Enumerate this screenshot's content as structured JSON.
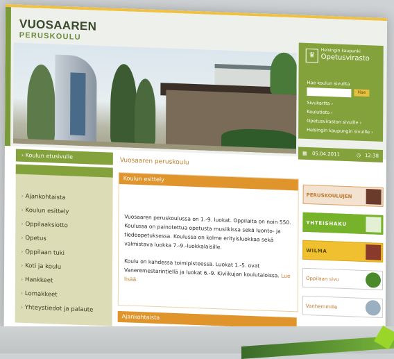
{
  "logo": {
    "line1": "VUOSAAREN",
    "line2": "PERUSKOULU"
  },
  "panel": {
    "org_small": "Helsingin kaupunki",
    "org_name": "Opetusvirasto",
    "search_label": "Hae koulun sivuilta",
    "search_value": "",
    "search_button": "Hae",
    "links": [
      "Sivukartta ›",
      "Koulutieto ›",
      "Opetusviraston sivuille ›",
      "Helsingin kaupungin sivuille ›"
    ]
  },
  "datebar": {
    "date": "05.04.2011",
    "time": "12:38"
  },
  "nav": {
    "front_tab": "Koulun etusivulle",
    "items": [
      "Ajankohtaista",
      "Koulun esittely",
      "Oppilaaksiotto",
      "Opetus",
      "Oppilaan tuki",
      "Koti ja koulu",
      "Hankkeet",
      "Lomakkeet",
      "Yhteystiedot ja palaute"
    ]
  },
  "breadcrumb": "Vuosaaren peruskoulu",
  "content": {
    "heading": "Koulun esittely",
    "para1": "Vuosaaren peruskoulussa on 1.-9. luokat. Oppilaita on noin 550. Koulussa on painotettua opetusta musiikissa sekä luonto- ja tiedeopetuksessa. Koulussa on kolme erityisluokkaa sekä valmistava luokka 7.-9.-luokkalaisille.",
    "para2": "Koulu on kahdessa toimipisteessä. Luokat 1.-5. ovat Vaneremestarintiellä ja luokat 6.-9. Kiviikujan koulutaloissa.",
    "more_link": "Lue lisää.",
    "heading2": "Ajankohtaista"
  },
  "banners": [
    "PERUSKOULUJEN ERIKOISTAITUMINEN",
    "YHTEISHAKU",
    "WILMA",
    "Oppilaan sivu",
    "Vanhemmille"
  ]
}
